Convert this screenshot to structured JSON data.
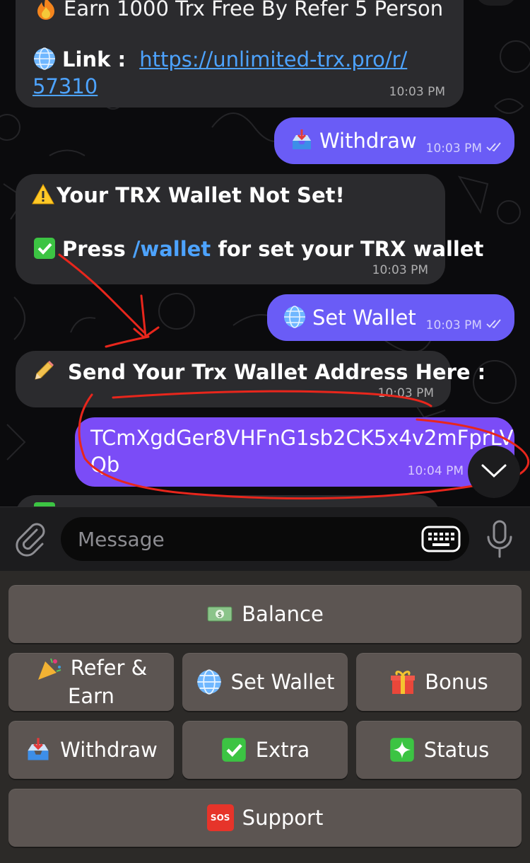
{
  "messages": [
    {
      "id": "m1",
      "direction": "incoming",
      "partial_line": "Earn 1000 Trx Free By Refer 5 Person",
      "link_label": "Link :",
      "link_line1": "https://unlimited-trx.pro/r/",
      "link_line2": "57310",
      "time": "10:03 PM"
    },
    {
      "id": "m2",
      "direction": "outgoing",
      "text": "Withdraw",
      "time": "10:03 PM",
      "icon": "inbox-tray-icon"
    },
    {
      "id": "m3",
      "direction": "incoming",
      "line1": "Your TRX Wallet Not Set!",
      "line2_pre": "Press ",
      "command": "/wallet",
      "line2_post": " for set your TRX wallet",
      "time": "10:03 PM"
    },
    {
      "id": "m4",
      "direction": "outgoing",
      "text": "Set Wallet",
      "time": "10:03 PM",
      "icon": "globe-icon"
    },
    {
      "id": "m5",
      "direction": "incoming",
      "text": "Send Your Trx Wallet Address Here :",
      "time": "10:03 PM",
      "icon": "pencil-icon"
    },
    {
      "id": "m6",
      "direction": "outgoing",
      "line1": "TCmXgdGer8VHFnG1sb2CK5x4v2mFprLV",
      "line2": "Qb",
      "time": "10:04 PM"
    }
  ],
  "composer": {
    "placeholder": "Message"
  },
  "keyboard": {
    "balance": "Balance",
    "refer_line1": "Refer &",
    "refer_line2": "Earn",
    "set_wallet": "Set Wallet",
    "bonus": "Bonus",
    "withdraw": "Withdraw",
    "extra": "Extra",
    "status": "Status",
    "support": "Support",
    "sos": "SOS"
  },
  "colors": {
    "outgoing": "#6a5cf6",
    "incoming": "#2b2b2e",
    "link": "#4da3ff",
    "annotation": "#e8261c",
    "highlighted": "#7b4cf7"
  }
}
